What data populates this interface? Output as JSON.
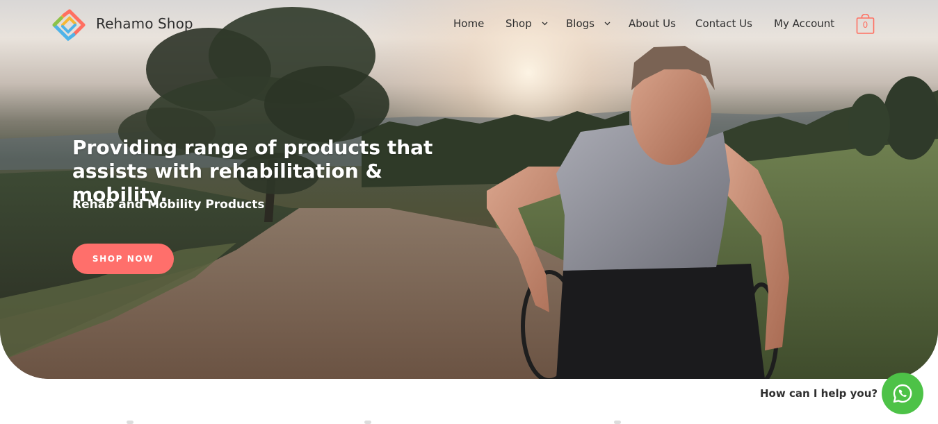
{
  "header": {
    "brand": "Rehamo Shop",
    "logo_icon": "rehamo-logo-icon",
    "nav": [
      {
        "label": "Home",
        "has_dropdown": false
      },
      {
        "label": "Shop",
        "has_dropdown": true
      },
      {
        "label": "Blogs",
        "has_dropdown": true
      },
      {
        "label": "About Us",
        "has_dropdown": false
      },
      {
        "label": "Contact Us",
        "has_dropdown": false
      },
      {
        "label": "My Account",
        "has_dropdown": false
      }
    ],
    "cart": {
      "icon": "shopping-bag-icon",
      "count": "0"
    }
  },
  "hero": {
    "headline": "Providing range of products that assists with rehabilitation & mobility.",
    "subheading": "Rehab and Mobility Products",
    "cta": "SHOP NOW",
    "image": "man-in-wheelchair-on-trail"
  },
  "chat": {
    "prompt": "How can I help you?",
    "icon": "whatsapp-icon"
  },
  "colors": {
    "accent": "#ff6f6b",
    "whatsapp": "#4dc247",
    "text": "#2f2f2f"
  }
}
